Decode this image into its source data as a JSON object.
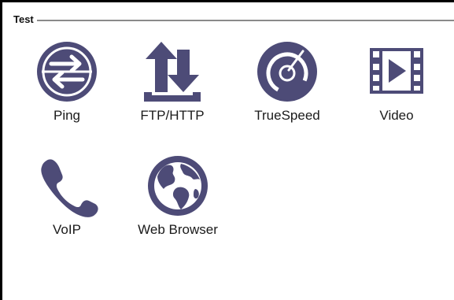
{
  "group": {
    "title": "Test"
  },
  "tiles": [
    {
      "label": "Ping",
      "icon": "ping-arrows-icon"
    },
    {
      "label": "FTP/HTTP",
      "icon": "upload-download-icon"
    },
    {
      "label": "TrueSpeed",
      "icon": "speedometer-icon"
    },
    {
      "label": "Video",
      "icon": "film-play-icon"
    },
    {
      "label": "VoIP",
      "icon": "phone-icon"
    },
    {
      "label": "Web Browser",
      "icon": "globe-icon"
    }
  ],
  "colors": {
    "icon": "#4d4b77",
    "border": "#000000",
    "rule": "#8a8a8a",
    "label": "#1a1a1a"
  }
}
